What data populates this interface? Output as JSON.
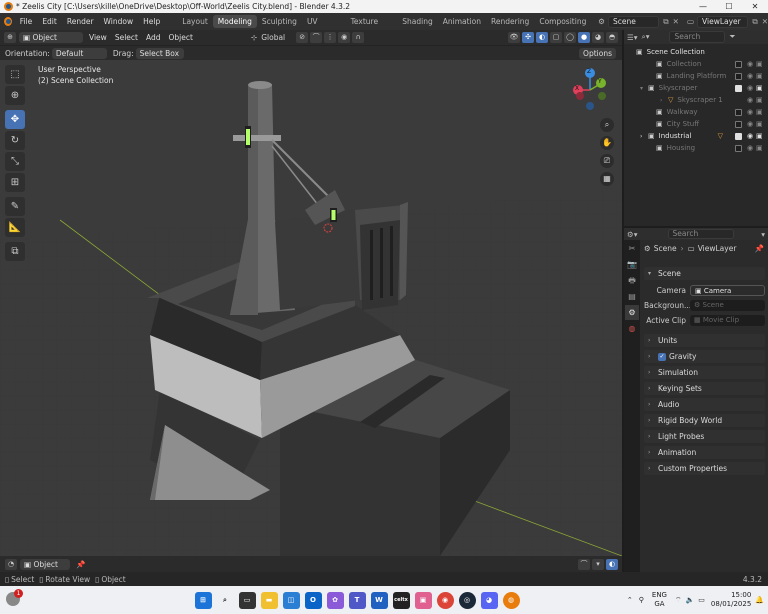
{
  "titlebar": {
    "title": "* Zeelis City [C:\\Users\\kille\\OneDrive\\Desktop\\Off-World\\Zeelis City.blend] - Blender 4.3.2",
    "minimize": "—",
    "maximize": "☐",
    "close": "✕"
  },
  "menu": {
    "items": [
      "File",
      "Edit",
      "Render",
      "Window",
      "Help"
    ]
  },
  "workspaces": [
    "Layout",
    "Modeling",
    "Sculpting",
    "UV Editing",
    "Texture Paint",
    "Shading",
    "Animation",
    "Rendering",
    "Compositing"
  ],
  "active_workspace": "Modeling",
  "scene_field": "Scene",
  "viewlayer_field": "ViewLayer",
  "viewport_header": {
    "mode": "Object Mode",
    "menus": [
      "View",
      "Select",
      "Add",
      "Object"
    ],
    "transform": "Global"
  },
  "tool_options": {
    "orientation_label": "Orientation:",
    "orientation_value": "Default",
    "drag_label": "Drag:",
    "drag_value": "Select Box",
    "options": "Options"
  },
  "viewport": {
    "line1": "User Perspective",
    "line2": "(2) Scene Collection"
  },
  "gizmo": {
    "x": "X",
    "y": "Y",
    "z": "Z",
    "colors": {
      "x": "#e0405c",
      "y": "#79b32c",
      "z": "#3a8ce0"
    }
  },
  "viewport_footer": {
    "object_mode": "Object"
  },
  "status": {
    "select": "Select",
    "rotate": "Rotate View",
    "object": "Object",
    "version": "4.3.2"
  },
  "outliner": {
    "search_placeholder": "Search",
    "root": "Scene Collection",
    "rows": [
      {
        "name": "Collection",
        "checked": false,
        "visible": false
      },
      {
        "name": "Landing Platform",
        "checked": false,
        "visible": false
      },
      {
        "name": "Skyscraper",
        "checked": true,
        "visible": false
      },
      {
        "name": "Skyscraper 1",
        "checked": false,
        "visible": false
      },
      {
        "name": "Walkway",
        "checked": false,
        "visible": false
      },
      {
        "name": "City Stuff",
        "checked": false,
        "visible": false
      },
      {
        "name": "Industrial",
        "checked": true,
        "visible": true
      },
      {
        "name": "Housing",
        "checked": false,
        "visible": false
      }
    ]
  },
  "properties": {
    "search_placeholder": "Search",
    "breadcrumb_scene": "Scene",
    "breadcrumb_viewlayer": "ViewLayer",
    "panel_title": "Scene",
    "camera_label": "Camera",
    "camera_value": "Camera",
    "background_label": "Backgroun...",
    "background_placeholder": "Scene",
    "clip_label": "Active Clip",
    "clip_placeholder": "Movie Clip",
    "sections": [
      "Units",
      "Gravity",
      "Simulation",
      "Keying Sets",
      "Audio",
      "Rigid Body World",
      "Light Probes",
      "Animation",
      "Custom Properties"
    ]
  },
  "taskbar": {
    "lang1": "ENG",
    "lang2": "GA",
    "time": "15:00",
    "date": "08/01/2025",
    "notif": "1"
  }
}
